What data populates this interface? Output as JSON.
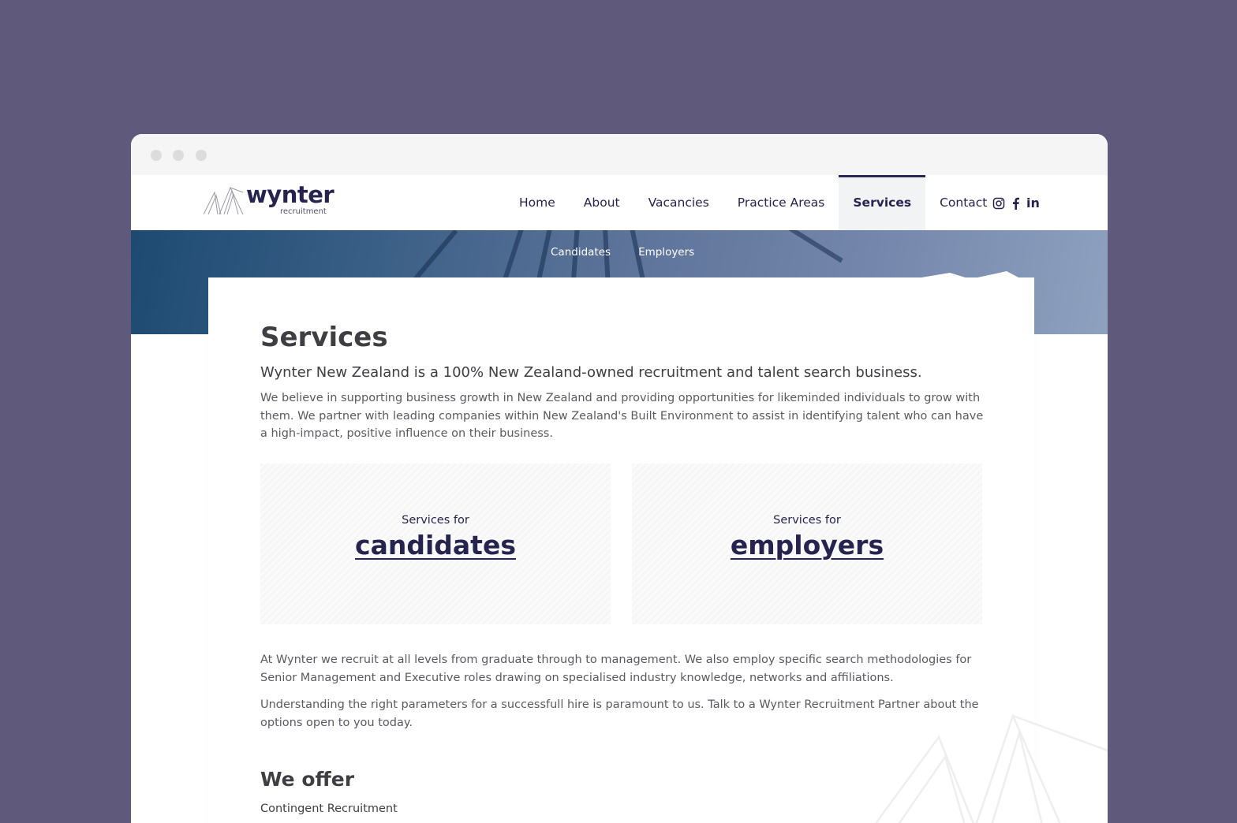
{
  "brand": {
    "name": "wynter",
    "tagline": "recruitment"
  },
  "nav": {
    "items": [
      {
        "label": "Home",
        "active": false
      },
      {
        "label": "About",
        "active": false
      },
      {
        "label": "Vacancies",
        "active": false
      },
      {
        "label": "Practice Areas",
        "active": false
      },
      {
        "label": "Services",
        "active": true
      },
      {
        "label": "Contact",
        "active": false
      }
    ],
    "social": [
      "instagram-icon",
      "facebook-icon",
      "linkedin-icon"
    ]
  },
  "subnav": {
    "items": [
      "Candidates",
      "Employers"
    ]
  },
  "main": {
    "title": "Services",
    "lead": "Wynter New Zealand is a 100% New Zealand-owned recruitment and talent search business.",
    "intro": "We believe in supporting business growth in New Zealand and providing opportunities for likeminded individuals to grow with them. We partner with leading companies within New Zealand's Built Environment to assist in identifying talent who can have a high-impact, positive influence on their business.",
    "cards": [
      {
        "small": "Services for",
        "big": "candidates"
      },
      {
        "small": "Services for",
        "big": "employers"
      }
    ],
    "para2": "At Wynter we recruit at all levels from graduate through to management. We also employ specific search methodologies for Senior Management and Executive roles drawing on specialised industry knowledge, networks and affiliations.",
    "para3": "Understanding the right parameters for a successfull hire is paramount to us. Talk to a Wynter Recruitment Partner about the options open to you today.",
    "offer_heading": "We offer",
    "offer_items": [
      "Contingent Recruitment"
    ]
  },
  "colors": {
    "background": "#5f5a7c",
    "brand": "#27234f",
    "text": "#3f3f43"
  }
}
